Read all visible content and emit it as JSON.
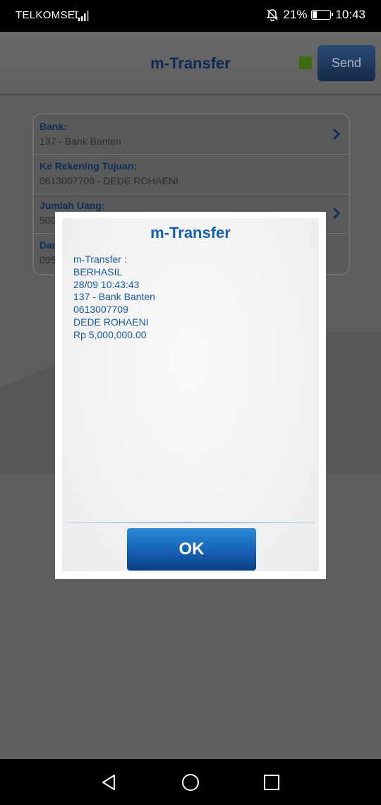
{
  "status_bar": {
    "carrier": "TELKOMSEL",
    "battery": "21%",
    "time": "10:43"
  },
  "app": {
    "title": "m-Transfer",
    "send_label": "Send",
    "fields": [
      {
        "label": "Bank:",
        "value": "137 - Bank Banten"
      },
      {
        "label": "Ke Rekening Tujuan:",
        "value": "0613007709 - DEDE ROHAENI"
      },
      {
        "label": "Jumlah Uang:",
        "value": "500"
      },
      {
        "label": "Dar",
        "value": "095"
      }
    ]
  },
  "dialog": {
    "title": "m-Transfer",
    "lines": [
      "m-Transfer :",
      "BERHASIL",
      "28/09 10:43:43",
      "137 - Bank Banten",
      "0613007709",
      "DEDE ROHAENI",
      "Rp 5,000,000.00"
    ],
    "ok_label": "OK"
  },
  "colors": {
    "dialog_title": "#1462b0",
    "ok_button": "#1665b8",
    "status_led": "#3d6a10"
  },
  "icons": [
    "signal-icon",
    "bell-off-icon",
    "battery-icon",
    "chevron-right-icon",
    "nav-back-icon",
    "nav-home-icon",
    "nav-recents-icon"
  ]
}
